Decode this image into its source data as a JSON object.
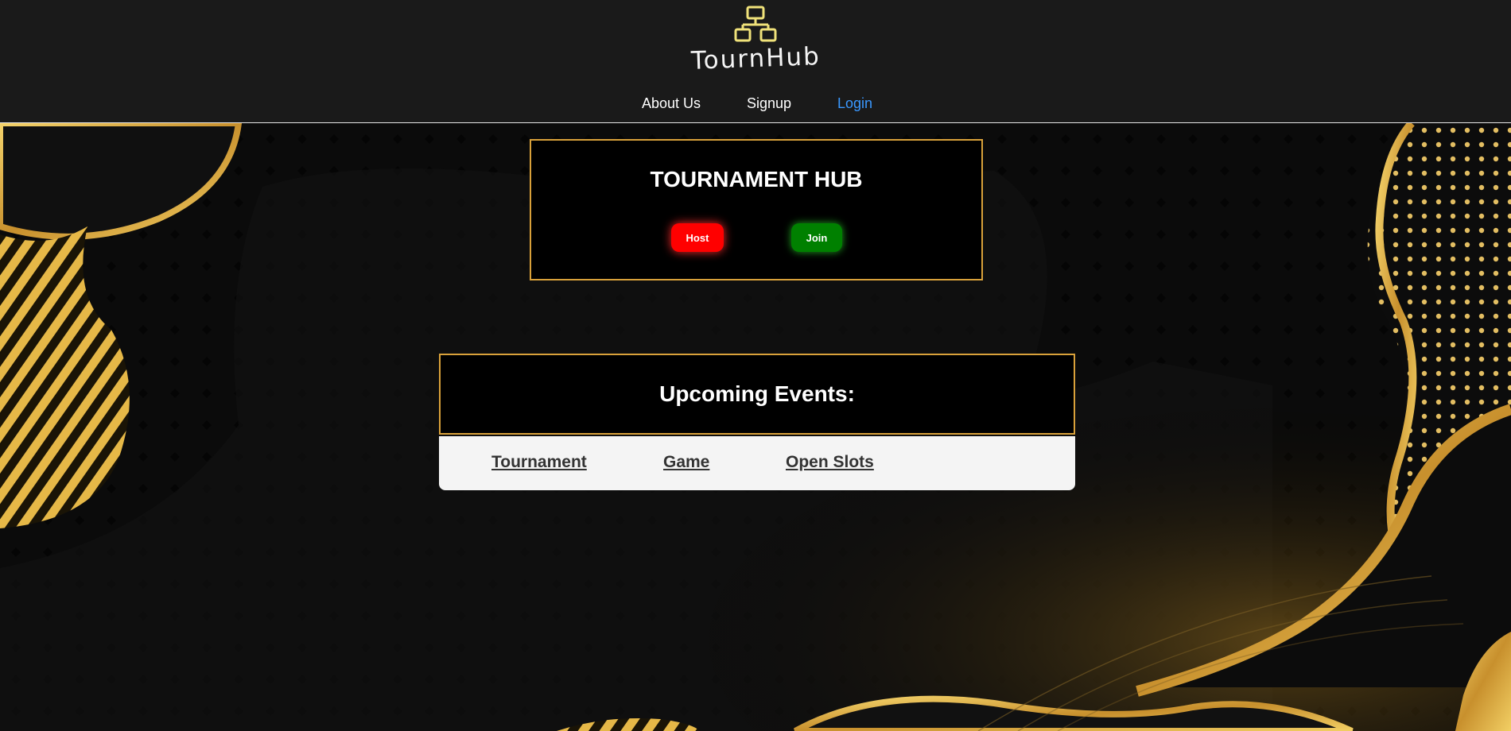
{
  "header": {
    "logo_text": "TournHub",
    "logo_icon": "network-hierarchy-icon",
    "nav": [
      {
        "label": "About Us"
      },
      {
        "label": "Signup"
      },
      {
        "label": "Login"
      }
    ]
  },
  "hub": {
    "title": "TOURNAMENT HUB",
    "host_label": "Host",
    "join_label": "Join"
  },
  "events": {
    "title": "Upcoming Events:",
    "columns": [
      "Tournament",
      "Game",
      "Open Slots"
    ]
  },
  "colors": {
    "accent_gold": "#d9a13a",
    "host_red": "#ff0000",
    "join_green": "#008000",
    "login_blue": "#3a98ff",
    "header_bg": "#1a1a1a"
  }
}
